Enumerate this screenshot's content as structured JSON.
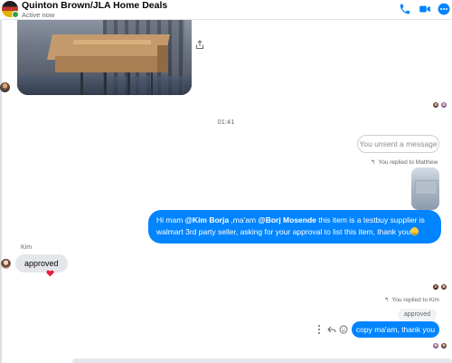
{
  "header": {
    "name": "Quinton Brown/JLA Home Deals",
    "status": "Active now"
  },
  "timeline": {
    "separator_time": "01:41"
  },
  "messages": {
    "unsent": "You unsent a message",
    "reply_note_1": "You replied to Matthew",
    "blue_message": {
      "part1": "Hi mam ",
      "mention1": "@Kim Borja",
      "part2": " ,ma'am ",
      "mention2": "@Borj Mosende",
      "part3": " this item is a testbuy supplier is walmart 3rd party seller, asking for your approval to list this item, thank you"
    },
    "kim_name": "Kim",
    "kim_reply": "approved",
    "reply_note_2": "You replied to Kim",
    "quoted_small": "approved",
    "final_message": "copy ma'am, thank you"
  },
  "colors": {
    "messenger_blue": "#0084ff",
    "grey_bubble": "#e4e6eb",
    "heart_red": "#e41e3f"
  },
  "icons": {
    "call": "phone-icon",
    "video": "video-camera-icon",
    "more": "more-dots-icon",
    "share": "share-icon",
    "reply": "reply-arrow-icon",
    "react": "smiley-react-icon",
    "more_actions": "vertical-dots-icon",
    "reaction": "heart-icon"
  }
}
